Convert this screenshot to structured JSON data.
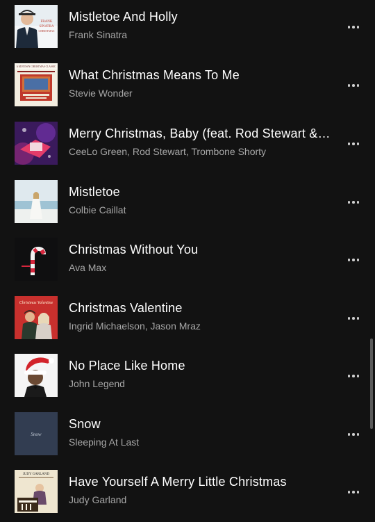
{
  "tracks": [
    {
      "title": "Mistletoe And Holly",
      "artist": "Frank Sinatra",
      "art": "album-art-frank-sinatra"
    },
    {
      "title": "What Christmas Means To Me",
      "artist": "Stevie Wonder",
      "art": "album-art-motown-christmas"
    },
    {
      "title": "Merry Christmas, Baby (feat. Rod Stewart & Trombone Shorty)",
      "artist": "CeeLo Green, Rod Stewart, Trombone Shorty",
      "art": "album-art-ceelo"
    },
    {
      "title": "Mistletoe",
      "artist": "Colbie Caillat",
      "art": "album-art-colbie"
    },
    {
      "title": "Christmas Without You",
      "artist": "Ava Max",
      "art": "album-art-candy-cane"
    },
    {
      "title": "Christmas Valentine",
      "artist": "Ingrid Michaelson, Jason Mraz",
      "art": "album-art-valentine"
    },
    {
      "title": "No Place Like Home",
      "artist": "John Legend",
      "art": "album-art-santa-hat"
    },
    {
      "title": "Snow",
      "artist": "Sleeping At Last",
      "art": "album-art-snow"
    },
    {
      "title": "Have Yourself A Merry Little Christmas",
      "artist": "Judy Garland",
      "art": "album-art-judy-garland"
    }
  ],
  "album_art_text": {
    "sinatra_line1": "FRANK",
    "sinatra_line2": "SINATRA",
    "sinatra_line3": "CHRISTMAS",
    "motown": "A MOTOWN CHRISTMAS CLASSIC",
    "valentine": "Christmas Valentine",
    "snow": "Snow",
    "judy": "JUDY GARLAND"
  },
  "colors": {
    "background": "#121212",
    "title": "#ffffff",
    "subtitle": "#a7a7a7",
    "dots": "#cfcfcf",
    "scrollbar": "#5a5a5a"
  }
}
